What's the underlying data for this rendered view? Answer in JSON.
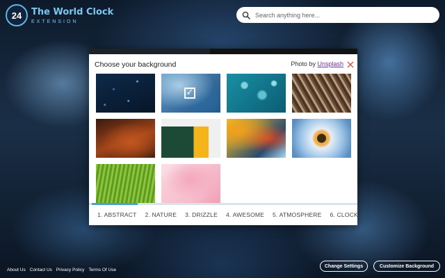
{
  "brand": {
    "logo_text": "24",
    "title": "The World Clock",
    "subtitle": "EXTENSION"
  },
  "search": {
    "placeholder": "Search anything here..."
  },
  "modal": {
    "title": "Choose your background",
    "credit_prefix": "Photo by",
    "credit_link": "Unsplash",
    "close_icon": "close-icon",
    "selected_index": 1,
    "check_glyph": "✓",
    "thumbnails": [
      {
        "name": "starry-night-sky",
        "background": "radial-gradient(circle at 30% 40%, #3a6fa8 0 1px, transparent 2px), radial-gradient(circle at 70% 20%, #6aa0d8 0 1px, transparent 2px), radial-gradient(circle at 55% 70%, #5a90c8 0 1px, transparent 2px), radial-gradient(circle at 15% 80%, #4a80b8 0 1px, transparent 2px), linear-gradient(160deg, #0e2a4a, #071628)"
      },
      {
        "name": "blue-ink-smoke",
        "background": "radial-gradient(ellipse at 30% 30%, #a9cde6, transparent 60%), radial-gradient(ellipse at 70% 70%, #2d6a9f, transparent 60%), linear-gradient(135deg, #5d96c4, #1e4f80)"
      },
      {
        "name": "teal-bokeh",
        "background": "radial-gradient(circle at 30% 30%, #7fd4dc 0 4px, transparent 6px), radial-gradient(circle at 60% 55%, #5fc2cc 0 5px, transparent 8px), radial-gradient(circle at 80% 25%, #8ee0e6 0 3px, transparent 5px), linear-gradient(135deg, #1a8fa3, #0b5d74)"
      },
      {
        "name": "stacked-books",
        "background": "repeating-linear-gradient(60deg, #4a3526 0 4px, #b99a7a 4px 7px, #6b4f38 7px 10px), linear-gradient(135deg, #3a2a1e, #8a6a4a)"
      },
      {
        "name": "canyon-rock",
        "background": "radial-gradient(ellipse at 60% 60%, #c2561e, transparent 60%), linear-gradient(160deg, #3a1a0e, #a0441a 55%, #4a200e)"
      },
      {
        "name": "green-door-yellow-wall",
        "background": "linear-gradient(90deg, transparent 0 0), linear-gradient(180deg, #f0f0f0 0 20%, transparent 20%), linear-gradient(90deg, #1d4a36 0 55%, #f5b41a 55% 80%, #f0f0f0 80%)"
      },
      {
        "name": "colored-paper-curves",
        "background": "radial-gradient(ellipse at 20% 30%, #f5a01a, transparent 55%), radial-gradient(ellipse at 70% 50%, #d0472a, transparent 50%), linear-gradient(135deg, #f7c62a, #2b4a6a 70%, #a9d6ee)"
      },
      {
        "name": "flower-macro",
        "background": "radial-gradient(circle at 50% 50%, #3a2a10 0 6px, #f0b050 7px 10px, #e6eef6 14px, #9cc4e6 30px, #5a8ec2 45px)"
      },
      {
        "name": "green-leaf",
        "background": "repeating-linear-gradient(100deg, #8cc63f 0 3px, #5e9a1e 3px 6px), linear-gradient(135deg, #b5e05a, #3f7a10)"
      },
      {
        "name": "pink-ink-smoke",
        "background": "radial-gradient(ellipse at 50% 40%, #f4a7bd, transparent 60%), radial-gradient(ellipse at 30% 70%, #f8c5d2, transparent 55%), linear-gradient(135deg, #fbe1e8, #f2a0b6)"
      }
    ],
    "tabs": [
      {
        "label": "1. ABSTRACT"
      },
      {
        "label": "2. NATURE"
      },
      {
        "label": "3. DRIZZLE"
      },
      {
        "label": "4. AWESOME"
      },
      {
        "label": "5. ATMOSPHERE"
      },
      {
        "label": "6. CLOCK"
      }
    ],
    "active_tab_index": 0
  },
  "footer": {
    "links": [
      "About Us",
      "Contact Us",
      "Privacy Policy",
      "Terms Of Use"
    ],
    "change_settings": "Change Settings",
    "customize_background": "Customize Background"
  },
  "colors": {
    "brand_accent": "#7dc6f0",
    "active_tab": "#4a9fd4",
    "close_icon": "#e0504a",
    "link": "#6a2fa0"
  }
}
